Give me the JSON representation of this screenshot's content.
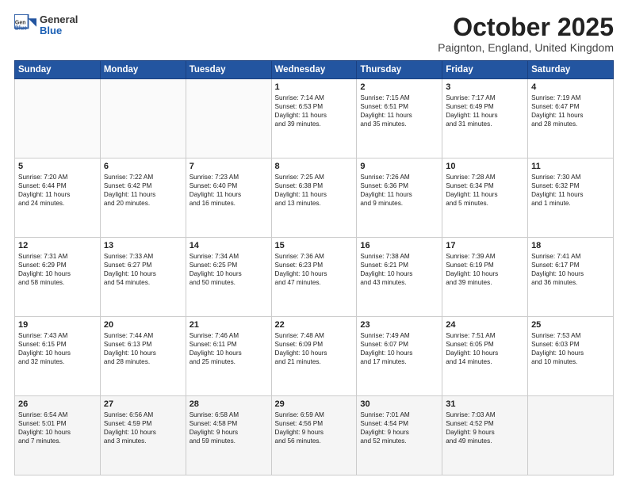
{
  "header": {
    "logo_general": "General",
    "logo_blue": "Blue",
    "month": "October 2025",
    "location": "Paignton, England, United Kingdom"
  },
  "weekdays": [
    "Sunday",
    "Monday",
    "Tuesday",
    "Wednesday",
    "Thursday",
    "Friday",
    "Saturday"
  ],
  "weeks": [
    [
      {
        "day": "",
        "text": ""
      },
      {
        "day": "",
        "text": ""
      },
      {
        "day": "",
        "text": ""
      },
      {
        "day": "1",
        "text": "Sunrise: 7:14 AM\nSunset: 6:53 PM\nDaylight: 11 hours\nand 39 minutes."
      },
      {
        "day": "2",
        "text": "Sunrise: 7:15 AM\nSunset: 6:51 PM\nDaylight: 11 hours\nand 35 minutes."
      },
      {
        "day": "3",
        "text": "Sunrise: 7:17 AM\nSunset: 6:49 PM\nDaylight: 11 hours\nand 31 minutes."
      },
      {
        "day": "4",
        "text": "Sunrise: 7:19 AM\nSunset: 6:47 PM\nDaylight: 11 hours\nand 28 minutes."
      }
    ],
    [
      {
        "day": "5",
        "text": "Sunrise: 7:20 AM\nSunset: 6:44 PM\nDaylight: 11 hours\nand 24 minutes."
      },
      {
        "day": "6",
        "text": "Sunrise: 7:22 AM\nSunset: 6:42 PM\nDaylight: 11 hours\nand 20 minutes."
      },
      {
        "day": "7",
        "text": "Sunrise: 7:23 AM\nSunset: 6:40 PM\nDaylight: 11 hours\nand 16 minutes."
      },
      {
        "day": "8",
        "text": "Sunrise: 7:25 AM\nSunset: 6:38 PM\nDaylight: 11 hours\nand 13 minutes."
      },
      {
        "day": "9",
        "text": "Sunrise: 7:26 AM\nSunset: 6:36 PM\nDaylight: 11 hours\nand 9 minutes."
      },
      {
        "day": "10",
        "text": "Sunrise: 7:28 AM\nSunset: 6:34 PM\nDaylight: 11 hours\nand 5 minutes."
      },
      {
        "day": "11",
        "text": "Sunrise: 7:30 AM\nSunset: 6:32 PM\nDaylight: 11 hours\nand 1 minute."
      }
    ],
    [
      {
        "day": "12",
        "text": "Sunrise: 7:31 AM\nSunset: 6:29 PM\nDaylight: 10 hours\nand 58 minutes."
      },
      {
        "day": "13",
        "text": "Sunrise: 7:33 AM\nSunset: 6:27 PM\nDaylight: 10 hours\nand 54 minutes."
      },
      {
        "day": "14",
        "text": "Sunrise: 7:34 AM\nSunset: 6:25 PM\nDaylight: 10 hours\nand 50 minutes."
      },
      {
        "day": "15",
        "text": "Sunrise: 7:36 AM\nSunset: 6:23 PM\nDaylight: 10 hours\nand 47 minutes."
      },
      {
        "day": "16",
        "text": "Sunrise: 7:38 AM\nSunset: 6:21 PM\nDaylight: 10 hours\nand 43 minutes."
      },
      {
        "day": "17",
        "text": "Sunrise: 7:39 AM\nSunset: 6:19 PM\nDaylight: 10 hours\nand 39 minutes."
      },
      {
        "day": "18",
        "text": "Sunrise: 7:41 AM\nSunset: 6:17 PM\nDaylight: 10 hours\nand 36 minutes."
      }
    ],
    [
      {
        "day": "19",
        "text": "Sunrise: 7:43 AM\nSunset: 6:15 PM\nDaylight: 10 hours\nand 32 minutes."
      },
      {
        "day": "20",
        "text": "Sunrise: 7:44 AM\nSunset: 6:13 PM\nDaylight: 10 hours\nand 28 minutes."
      },
      {
        "day": "21",
        "text": "Sunrise: 7:46 AM\nSunset: 6:11 PM\nDaylight: 10 hours\nand 25 minutes."
      },
      {
        "day": "22",
        "text": "Sunrise: 7:48 AM\nSunset: 6:09 PM\nDaylight: 10 hours\nand 21 minutes."
      },
      {
        "day": "23",
        "text": "Sunrise: 7:49 AM\nSunset: 6:07 PM\nDaylight: 10 hours\nand 17 minutes."
      },
      {
        "day": "24",
        "text": "Sunrise: 7:51 AM\nSunset: 6:05 PM\nDaylight: 10 hours\nand 14 minutes."
      },
      {
        "day": "25",
        "text": "Sunrise: 7:53 AM\nSunset: 6:03 PM\nDaylight: 10 hours\nand 10 minutes."
      }
    ],
    [
      {
        "day": "26",
        "text": "Sunrise: 6:54 AM\nSunset: 5:01 PM\nDaylight: 10 hours\nand 7 minutes."
      },
      {
        "day": "27",
        "text": "Sunrise: 6:56 AM\nSunset: 4:59 PM\nDaylight: 10 hours\nand 3 minutes."
      },
      {
        "day": "28",
        "text": "Sunrise: 6:58 AM\nSunset: 4:58 PM\nDaylight: 9 hours\nand 59 minutes."
      },
      {
        "day": "29",
        "text": "Sunrise: 6:59 AM\nSunset: 4:56 PM\nDaylight: 9 hours\nand 56 minutes."
      },
      {
        "day": "30",
        "text": "Sunrise: 7:01 AM\nSunset: 4:54 PM\nDaylight: 9 hours\nand 52 minutes."
      },
      {
        "day": "31",
        "text": "Sunrise: 7:03 AM\nSunset: 4:52 PM\nDaylight: 9 hours\nand 49 minutes."
      },
      {
        "day": "",
        "text": ""
      }
    ]
  ]
}
